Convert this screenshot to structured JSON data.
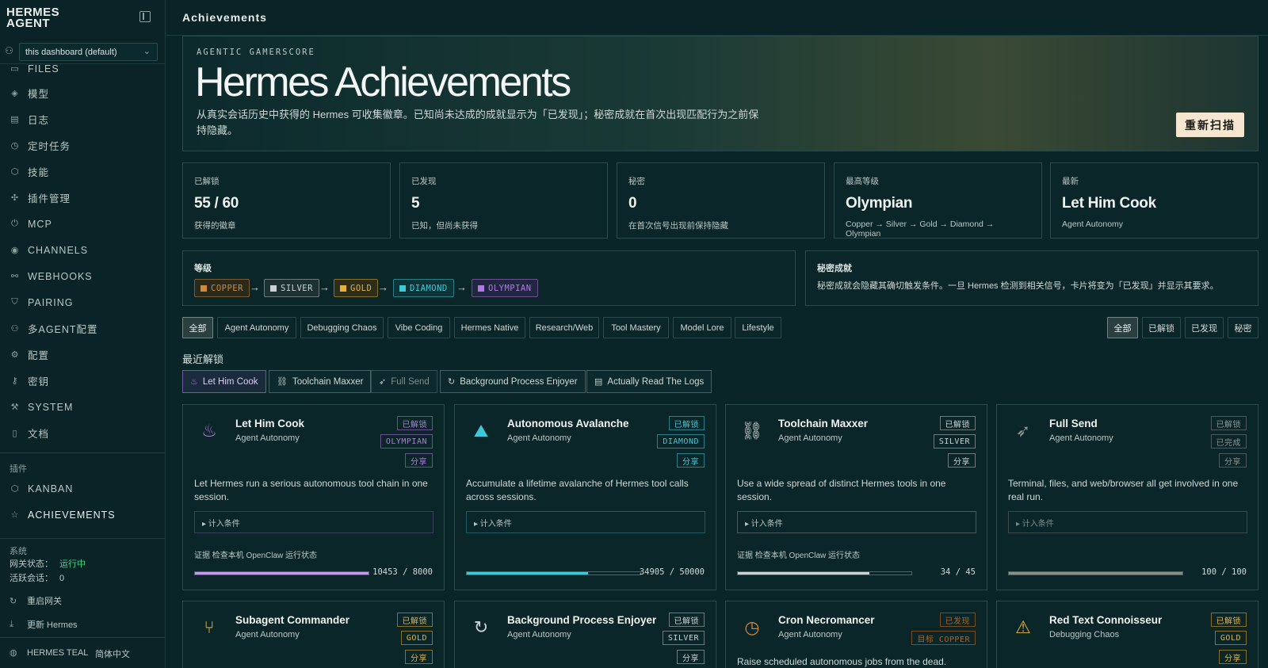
{
  "sidebar": {
    "brand_line1": "HERMES",
    "brand_line2": "AGENT",
    "profile_select": "this dashboard (default)",
    "items": [
      {
        "label": "FILES",
        "icon": "file-icon"
      },
      {
        "label": "模型",
        "icon": "model-icon"
      },
      {
        "label": "日志",
        "icon": "log-icon"
      },
      {
        "label": "定时任务",
        "icon": "clock-icon"
      },
      {
        "label": "技能",
        "icon": "skill-icon"
      },
      {
        "label": "插件管理",
        "icon": "plugin-icon"
      },
      {
        "label": "MCP",
        "icon": "plug-icon"
      },
      {
        "label": "CHANNELS",
        "icon": "broadcast-icon"
      },
      {
        "label": "WEBHOOKS",
        "icon": "webhook-icon"
      },
      {
        "label": "PAIRING",
        "icon": "shield-icon"
      },
      {
        "label": "多AGENT配置",
        "icon": "users-icon"
      },
      {
        "label": "配置",
        "icon": "gear-icon"
      },
      {
        "label": "密钥",
        "icon": "key-icon"
      },
      {
        "label": "SYSTEM",
        "icon": "wrench-icon"
      },
      {
        "label": "文档",
        "icon": "book-icon"
      }
    ],
    "plugins_label": "插件",
    "plugin_items": [
      {
        "label": "KANBAN",
        "icon": "kanban-icon"
      },
      {
        "label": "ACHIEVEMENTS",
        "icon": "star-icon"
      }
    ],
    "system_label": "系统",
    "gateway_label": "网关状态：",
    "gateway_value": "运行中",
    "sessions_label": "活跃会话：",
    "sessions_value": "0",
    "restart_label": "重启网关",
    "update_label": "更新 Hermes",
    "theme_label": "HERMES TEAL",
    "lang_label": "简体中文"
  },
  "topbar": {
    "title": "Achievements"
  },
  "hero": {
    "kicker": "AGENTIC GAMERSCORE",
    "title": "Hermes Achievements",
    "desc": "从真实会话历史中获得的 Hermes 可收集徽章。已知尚未达成的成就显示为「已发现」；秘密成就在首次出现匹配行为之前保持隐藏。",
    "rescan": "重新扫描"
  },
  "stats": [
    {
      "label": "已解锁",
      "value": "55 / 60",
      "sub": "获得的徽章"
    },
    {
      "label": "已发现",
      "value": "5",
      "sub": "已知，但尚未获得"
    },
    {
      "label": "秘密",
      "value": "0",
      "sub": "在首次信号出现前保持隐藏"
    },
    {
      "label": "最高等级",
      "value": "Olympian",
      "sub": "Copper → Silver → Gold → Diamond → Olympian"
    },
    {
      "label": "最新",
      "value": "Let Him Cook",
      "sub": "Agent Autonomy"
    }
  ],
  "tiers": {
    "title": "等级",
    "items": [
      {
        "label": "COPPER",
        "color": "#d08a3a"
      },
      {
        "label": "SILVER",
        "color": "#c9d2d4"
      },
      {
        "label": "GOLD",
        "color": "#e8b23a"
      },
      {
        "label": "DIAMOND",
        "color": "#3fc9d8"
      },
      {
        "label": "OLYMPIAN",
        "color": "#b27ae0"
      }
    ]
  },
  "secret_panel": {
    "title": "秘密成就",
    "text": "秘密成就会隐藏其确切触发条件。一旦 Hermes 检测到相关信号，卡片将变为「已发现」并显示其要求。"
  },
  "category_filters": [
    "全部",
    "Agent Autonomy",
    "Debugging Chaos",
    "Vibe Coding",
    "Hermes Native",
    "Research/Web",
    "Tool Mastery",
    "Model Lore",
    "Lifestyle"
  ],
  "status_filters": [
    "全部",
    "已解锁",
    "已发现",
    "秘密"
  ],
  "recent_title": "最近解锁",
  "recent": [
    "Let Him Cook",
    "Toolchain Maxxer",
    "Full Send",
    "Background Process Enjoyer",
    "Actually Read The Logs"
  ],
  "cards": [
    {
      "name": "Let Him Cook",
      "category": "Agent Autonomy",
      "status": "已解锁",
      "tier": "OLYMPIAN",
      "share": "分享",
      "desc": "Let Hermes run a serious autonomous tool chain in one session.",
      "cond": "▸ 计入条件",
      "evidence": "证据  检查本机 OpenClaw 运行状态",
      "progress_text": "10453 / 8000",
      "progress": 1.0,
      "icon": "flame-icon",
      "accent": "#b27ae0"
    },
    {
      "name": "Autonomous Avalanche",
      "category": "Agent Autonomy",
      "status": "已解锁",
      "tier": "DIAMOND",
      "share": "分享",
      "desc": "Accumulate a lifetime avalanche of Hermes tool calls across sessions.",
      "cond": "▸ 计入条件",
      "evidence": "",
      "progress_text": "34905 / 50000",
      "progress": 0.698,
      "icon": "avalanche-icon",
      "accent": "#3fc9d8"
    },
    {
      "name": "Toolchain Maxxer",
      "category": "Agent Autonomy",
      "status": "已解锁",
      "tier": "SILVER",
      "share": "分享",
      "desc": "Use a wide spread of distinct Hermes tools in one session.",
      "cond": "▸ 计入条件",
      "evidence": "证据  检查本机 OpenClaw 运行状态",
      "progress_text": "34 / 45",
      "progress": 0.756,
      "icon": "network-icon",
      "accent": "#c9d2d4"
    },
    {
      "name": "Full Send",
      "category": "Agent Autonomy",
      "status": "已解锁",
      "tier": "已完成",
      "share": "分享",
      "desc": "Terminal, files, and web/browser all get involved in one real run.",
      "cond": "▸ 计入条件",
      "evidence": "",
      "progress_text": "100 / 100",
      "progress": 1.0,
      "icon": "rocket-icon",
      "accent": "#8a9694"
    },
    {
      "name": "Subagent Commander",
      "category": "Agent Autonomy",
      "status": "已解锁",
      "tier": "GOLD",
      "share": "分享",
      "desc": "",
      "icon": "branch-icon",
      "accent": "#e8b23a"
    },
    {
      "name": "Background Process Enjoyer",
      "category": "Agent Autonomy",
      "status": "已解锁",
      "tier": "SILVER",
      "share": "分享",
      "desc": "",
      "icon": "refresh-icon",
      "accent": "#c9d2d4"
    },
    {
      "name": "Cron Necromancer",
      "category": "Agent Autonomy",
      "status": "已发现",
      "tier": "目标 COPPER",
      "share": "",
      "desc": "Raise scheduled autonomous jobs from the dead.",
      "icon": "clock-icon",
      "accent": "#d08a3a"
    },
    {
      "name": "Red Text Connoisseur",
      "category": "Debugging Chaos",
      "status": "已解锁",
      "tier": "GOLD",
      "share": "分享",
      "desc": "",
      "icon": "warning-icon",
      "accent": "#e8b23a"
    }
  ]
}
